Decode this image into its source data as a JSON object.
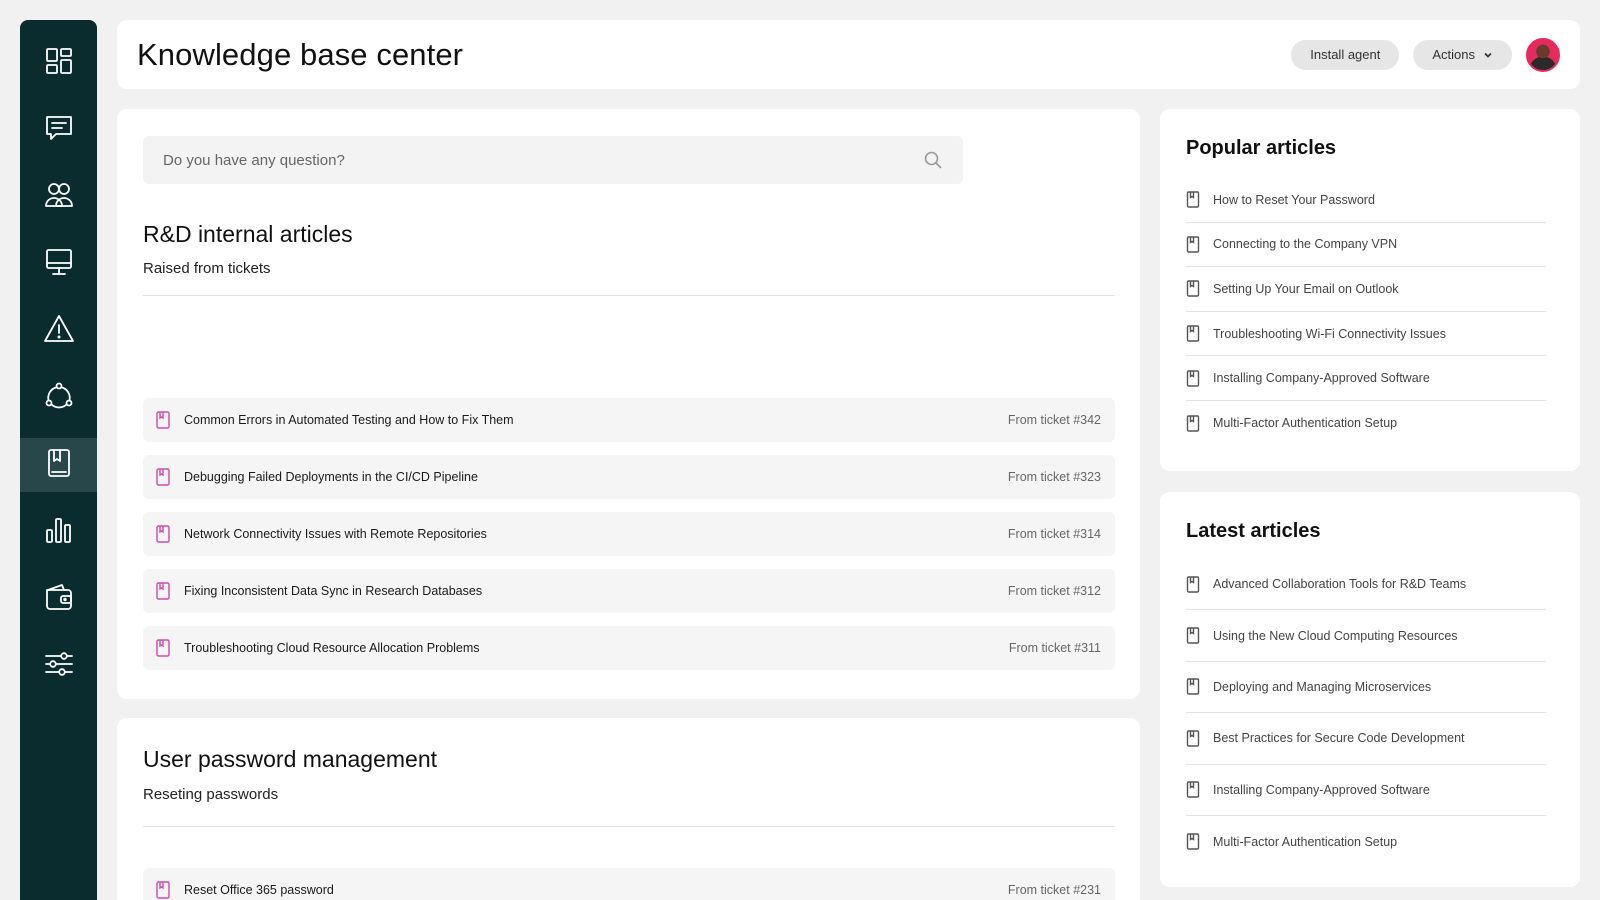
{
  "header": {
    "title": "Knowledge base center",
    "install_label": "Install agent",
    "actions_label": "Actions"
  },
  "sidebar": {
    "items": [
      {
        "icon": "dashboard-icon",
        "active": false
      },
      {
        "icon": "chat-icon",
        "active": false
      },
      {
        "icon": "users-icon",
        "active": false
      },
      {
        "icon": "monitor-icon",
        "active": false
      },
      {
        "icon": "alert-icon",
        "active": false
      },
      {
        "icon": "network-icon",
        "active": false
      },
      {
        "icon": "book-icon",
        "active": true
      },
      {
        "icon": "chart-icon",
        "active": false
      },
      {
        "icon": "wallet-icon",
        "active": false
      },
      {
        "icon": "settings-sliders-icon",
        "active": false
      }
    ]
  },
  "search": {
    "placeholder": "Do you have any question?"
  },
  "rd_section": {
    "title": "R&D internal articles",
    "subtitle": "Raised from tickets",
    "tickets": [
      {
        "title": "Common Errors in Automated Testing and How to Fix Them",
        "ref": "From ticket #342"
      },
      {
        "title": "Debugging Failed Deployments in the CI/CD Pipeline",
        "ref": "From ticket #323"
      },
      {
        "title": "Network Connectivity Issues with Remote Repositories",
        "ref": "From ticket #314"
      },
      {
        "title": "Fixing Inconsistent Data Sync in Research Databases",
        "ref": "From ticket #312"
      },
      {
        "title": "Troubleshooting Cloud Resource Allocation Problems",
        "ref": "From ticket #311"
      }
    ]
  },
  "pw_section": {
    "title": "User password management",
    "subtitle": "Reseting passwords",
    "tickets": [
      {
        "title": "Reset Office 365 password",
        "ref": "From ticket #231"
      }
    ]
  },
  "popular": {
    "title": "Popular articles",
    "items": [
      "How to Reset Your Password",
      "Connecting to the Company VPN",
      "Setting Up Your Email on Outlook",
      "Troubleshooting Wi-Fi Connectivity Issues",
      "Installing Company-Approved Software",
      "Multi-Factor Authentication Setup"
    ]
  },
  "latest": {
    "title": "Latest articles",
    "items": [
      "Advanced Collaboration Tools for R&D Teams",
      "Using the New Cloud Computing Resources",
      "Deploying and Managing Microservices",
      "Best Practices for Secure Code Development",
      "Installing Company-Approved Software",
      "Multi-Factor Authentication Setup"
    ]
  },
  "colors": {
    "sidebar_bg": "#0b2c2f",
    "sidebar_active": "#27474a",
    "doc_icon_accent": "#d34aa8",
    "avatar_ring": "#e52a5c"
  }
}
